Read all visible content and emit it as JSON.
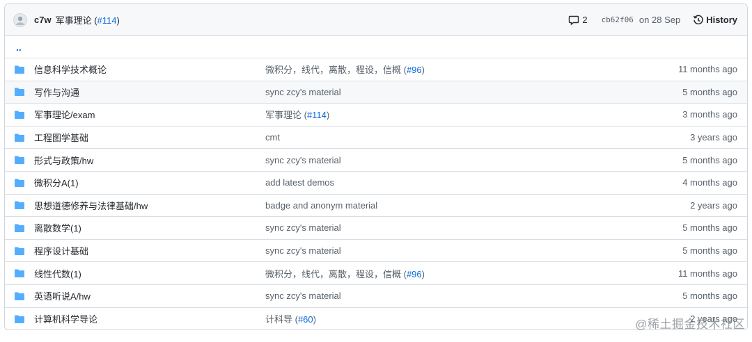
{
  "header": {
    "author": "c7w",
    "message": "军事理论",
    "pr_prefix": " (",
    "pr_link": "#114",
    "pr_suffix": ")",
    "comment_count": "2",
    "sha": "cb62f06",
    "date": "on 28 Sep",
    "history_label": "History"
  },
  "up_label": "..",
  "rows": [
    {
      "name": "信息科学技术概论",
      "msg": "微积分，线代，离散，程设，信概 (",
      "link": "#96",
      "suffix": ")",
      "age": "11 months ago"
    },
    {
      "name": "写作与沟通",
      "msg": "sync zcy's material",
      "link": "",
      "suffix": "",
      "age": "5 months ago"
    },
    {
      "name": "军事理论/exam",
      "msg": "军事理论 (",
      "link": "#114",
      "suffix": ")",
      "age": "3 months ago"
    },
    {
      "name": "工程图学基础",
      "msg": "cmt",
      "link": "",
      "suffix": "",
      "age": "3 years ago"
    },
    {
      "name": "形式与政策/hw",
      "msg": "sync zcy's material",
      "link": "",
      "suffix": "",
      "age": "5 months ago"
    },
    {
      "name": "微积分A(1)",
      "msg": "add latest demos",
      "link": "",
      "suffix": "",
      "age": "4 months ago"
    },
    {
      "name": "思想道德修养与法律基础/hw",
      "msg": "badge and anonym material",
      "link": "",
      "suffix": "",
      "age": "2 years ago"
    },
    {
      "name": "离散数学(1)",
      "msg": "sync zcy's material",
      "link": "",
      "suffix": "",
      "age": "5 months ago"
    },
    {
      "name": "程序设计基础",
      "msg": "sync zcy's material",
      "link": "",
      "suffix": "",
      "age": "5 months ago"
    },
    {
      "name": "线性代数(1)",
      "msg": "微积分，线代，离散，程设，信概 (",
      "link": "#96",
      "suffix": ")",
      "age": "11 months ago"
    },
    {
      "name": "英语听说A/hw",
      "msg": "sync zcy's material",
      "link": "",
      "suffix": "",
      "age": "5 months ago"
    },
    {
      "name": "计算机科学导论",
      "msg": "计科导 (",
      "link": "#60",
      "suffix": ")",
      "age": "2 years ago"
    }
  ],
  "watermark": "@稀土掘金技术社区",
  "colors": {
    "folder": "#54aeff",
    "link": "#0969da",
    "border": "#d0d7de"
  }
}
